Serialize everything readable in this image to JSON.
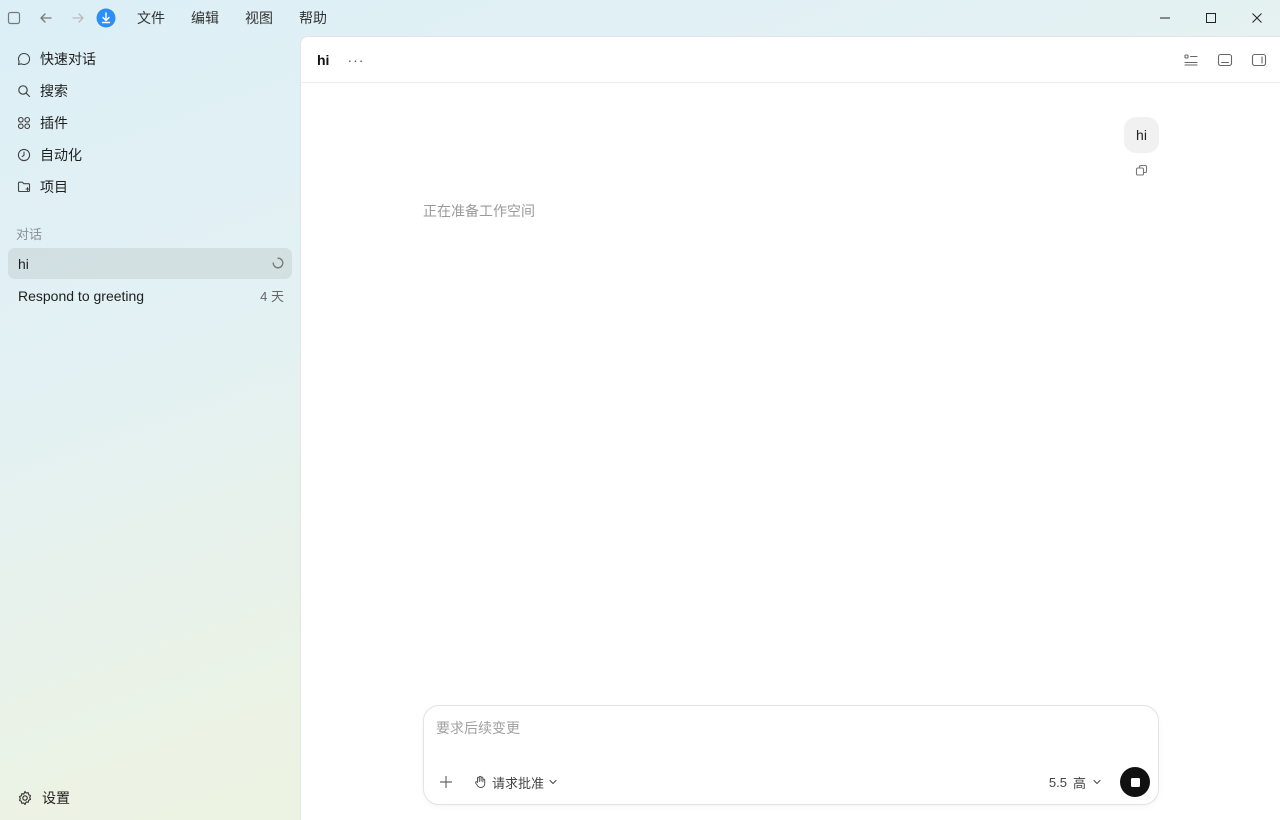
{
  "menu": {
    "items": [
      "文件",
      "编辑",
      "视图",
      "帮助"
    ]
  },
  "sidebar": {
    "nav": [
      {
        "label": "快速对话",
        "icon": "chat-bubble-icon"
      },
      {
        "label": "搜索",
        "icon": "search-icon"
      },
      {
        "label": "插件",
        "icon": "plugins-grid-icon"
      },
      {
        "label": "自动化",
        "icon": "clock-icon"
      },
      {
        "label": "项目",
        "icon": "folder-icon"
      }
    ],
    "section_label": "对话",
    "conversations": [
      {
        "title": "hi",
        "status": "loading"
      },
      {
        "title": "Respond to greeting",
        "time": "4 天"
      }
    ],
    "settings_label": "设置"
  },
  "main": {
    "title": "hi",
    "more_label": "···",
    "user_message": "hi",
    "status": "正在准备工作空间",
    "composer": {
      "placeholder": "要求后续变更",
      "approval_label": "请求批准",
      "model": "5.5",
      "effort": "高"
    }
  },
  "colors": {
    "accent": "#2f8ff0",
    "stop_button": "#111111"
  }
}
